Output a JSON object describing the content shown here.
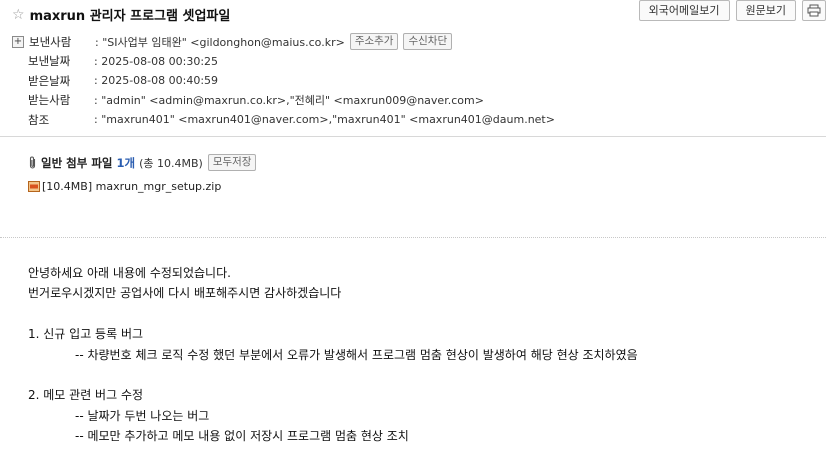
{
  "subject": "maxrun 관리자 프로그램 셋업파일",
  "top_buttons": {
    "foreign_mail": "외국어메일보기",
    "original": "원문보기"
  },
  "header": {
    "from_label": "보낸사람",
    "from_value": ": \"SI사업부 임태완\" <gildonghon@maius.co.kr>",
    "add_contact": "주소추가",
    "block": "수신차단",
    "sent_label": "보낸날짜",
    "sent_value": ": 2025-08-08 00:30:25",
    "received_label": "받은날짜",
    "received_value": ": 2025-08-08 00:40:59",
    "to_label": "받는사람",
    "to_value": ": \"admin\" <admin@maxrun.co.kr>,\"전혜리\" <maxrun009@naver.com>",
    "cc_label": "참조",
    "cc_value": ": \"maxrun401\" <maxrun401@naver.com>,\"maxrun401\" <maxrun401@daum.net>"
  },
  "attachments": {
    "title": "일반 첨부 파일",
    "count": "1개",
    "total_size": "(총 10.4MB)",
    "save_all": "모두저장",
    "file": "[10.4MB] maxrun_mgr_setup.zip"
  },
  "body": {
    "l1": "안녕하세요 아래 내용에 수정되었습니다.",
    "l2": "번거로우시겠지만 공업사에 다시 배포해주시면 감사하겠습니다",
    "l3": "1. 신규 입고 등록 버그",
    "l4": "-- 차량번호 체크 로직 수정 했던 부분에서 오류가 발생해서 프로그램 멈춤 현상이 발생하여 해당 현상 조치하였음",
    "l5": "2. 메모 관련 버그 수정",
    "l6": "-- 날짜가 두번 나오는 버그",
    "l7": "-- 메모만 추가하고 메모 내용 없이 저장시 프로그램 멈춤 현상 조치"
  }
}
